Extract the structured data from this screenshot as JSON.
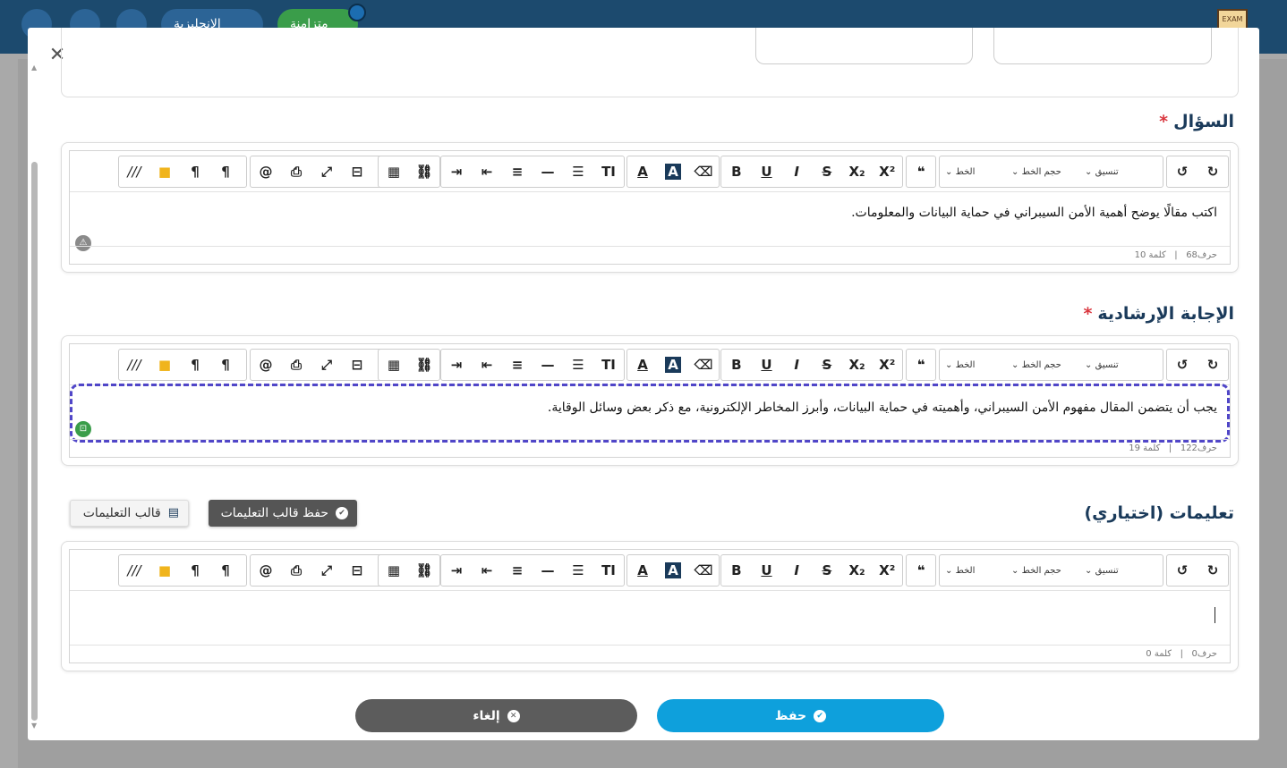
{
  "topbar": {
    "language_label": "الإنجليزية",
    "status_label": "متزامنة",
    "logo_text": "EXAM"
  },
  "modal": {
    "close": "✕"
  },
  "question": {
    "title": "السؤال",
    "required_mark": "*",
    "content": "اكتب مقالًا يوضح أهمية الأمن السيبراني في حماية البيانات والمعلومات.",
    "char_count": "حرف68",
    "word_count": "كلمة 10"
  },
  "answer": {
    "title": "الإجابة الإرشادية",
    "required_mark": "*",
    "content": "يجب أن يتضمن المقال مفهوم الأمن السيبراني، وأهميته في حماية البيانات، وأبرز المخاطر الإلكترونية، مع ذكر بعض وسائل الوقاية.",
    "char_count": "حرف122",
    "word_count": "كلمة 19"
  },
  "instructions": {
    "title": "تعليمات (اختياري)",
    "save_template_label": "حفظ قالب التعليمات",
    "template_label": "قالب التعليمات",
    "content": "",
    "char_count": "حرف0",
    "word_count": "كلمة 0"
  },
  "toolbar": {
    "format_label": "تنسيق",
    "size_label": "حجم الخط",
    "font_label": "الخط",
    "separator": "|"
  },
  "footer": {
    "save_label": "حفظ",
    "cancel_label": "إلغاء"
  },
  "colors": {
    "primary": "#0ea0dc",
    "cancel": "#5c5c5c",
    "dashed": "#5046c8",
    "title": "#1a3a5a"
  }
}
